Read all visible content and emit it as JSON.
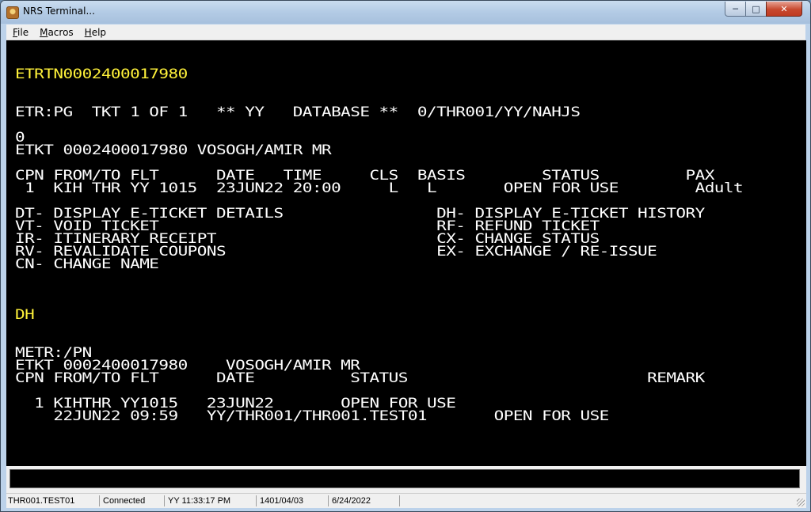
{
  "window": {
    "title": "NRS Terminal..."
  },
  "menu": {
    "items": [
      "File",
      "Macros",
      "Help"
    ]
  },
  "terminal": {
    "lines": [
      {
        "text": "ETRTN0002400017980",
        "color": "yellow",
        "row": 0
      },
      {
        "text": "ETR:PG  TKT 1 OF 1   ** YY   DATABASE **  0/THR001/YY/NAHJS",
        "color": "white",
        "row": 1
      },
      {
        "text": "0",
        "color": "white",
        "row": 2
      },
      {
        "text": "ETKT 0002400017980 VOSOGH/AMIR MR",
        "color": "white",
        "row": 3
      },
      {
        "text": "CPN FROM/TO FLT      DATE   TIME     CLS  BASIS        STATUS         PAX",
        "color": "white",
        "row": 4
      },
      {
        "text": " 1  KIH THR YY 1015  23JUN22 20:00     L   L       OPEN FOR USE        Adult",
        "color": "white",
        "row": 5
      },
      {
        "text": "DT- DISPLAY E-TICKET DETAILS                DH- DISPLAY E-TICKET HISTORY",
        "color": "white",
        "row": 6
      },
      {
        "text": "VT- VOID TICKET                             RF- REFUND TICKET",
        "color": "white",
        "row": 7
      },
      {
        "text": "IR- ITINERARY RECEIPT                       CX- CHANGE STATUS",
        "color": "white",
        "row": 8
      },
      {
        "text": "RV- REVALIDATE COUPONS                      EX- EXCHANGE / RE-ISSUE",
        "color": "white",
        "row": 9
      },
      {
        "text": "CN- CHANGE NAME",
        "color": "white",
        "row": 10
      },
      {
        "text": "DH",
        "color": "yellow",
        "row": 11
      },
      {
        "text": "METR:/PN",
        "color": "white",
        "row": 12
      },
      {
        "text": "ETKT 0002400017980    VOSOGH/AMIR MR",
        "color": "white",
        "row": 13
      },
      {
        "text": "CPN FROM/TO FLT      DATE          STATUS                         REMARK",
        "color": "white",
        "row": 14
      },
      {
        "text": "  1 KIHTHR YY1015   23JUN22       OPEN FOR USE",
        "color": "white",
        "row": 15
      },
      {
        "text": "    22JUN22 09:59   YY/THR001/THR001.TEST01       OPEN FOR USE",
        "color": "white",
        "row": 16
      }
    ]
  },
  "command": {
    "value": ""
  },
  "status": {
    "user": "THR001.TEST01",
    "connection": "Connected",
    "time": "YY 11:33:17 PM",
    "date_jalali": "1401/04/03",
    "date": "6/24/2022"
  },
  "colors": {
    "yellow": "#fff23a",
    "white": "#ffffff",
    "background": "#000000"
  }
}
